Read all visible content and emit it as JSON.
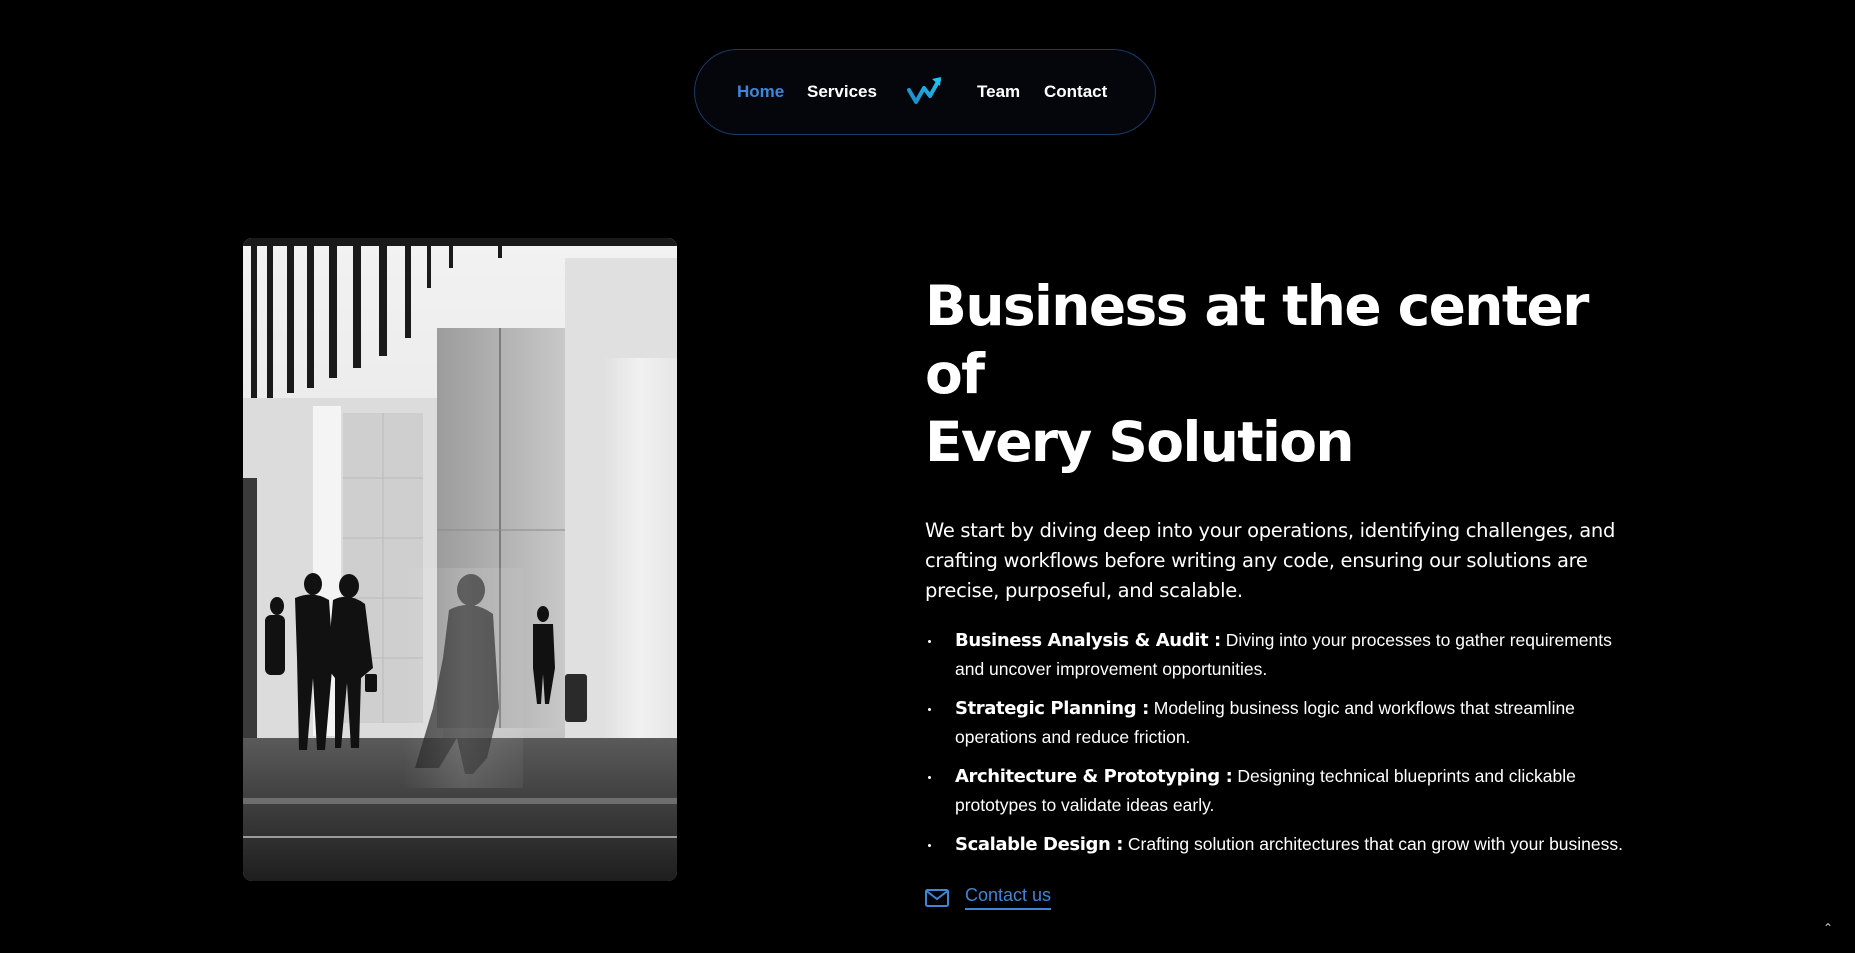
{
  "nav": {
    "items": [
      {
        "label": "Home",
        "active": true
      },
      {
        "label": "Services",
        "active": false
      },
      {
        "label": "Team",
        "active": false
      },
      {
        "label": "Contact",
        "active": false
      }
    ],
    "logo_icon": "trend-arrow-logo-icon"
  },
  "hero": {
    "headline_line1": "Business at the center of",
    "headline_line2": "Every Solution",
    "intro": "We start by diving deep into your operations, identifying challenges, and crafting workflows before writing any code, ensuring our solutions are precise, purposeful, and scalable.",
    "features": [
      {
        "title": "Business Analysis & Audit :",
        "text": " Diving into your processes to gather requirements and uncover improvement opportunities."
      },
      {
        "title": "Strategic Planning :",
        "text": " Modeling business logic and workflows that streamline operations and reduce friction."
      },
      {
        "title": "Architecture & Prototyping :",
        "text": " Designing technical blueprints and clickable prototypes to validate ideas early."
      },
      {
        "title": "Scalable Design :",
        "text": " Crafting solution architectures that can grow with your business."
      }
    ],
    "contact_label": "Contact us",
    "contact_icon": "envelope-icon"
  },
  "scroll_top_icon": "chevron-up-icon",
  "colors": {
    "background": "#000000",
    "accent": "#3f86d6",
    "nav_border": "#1b3a66"
  }
}
